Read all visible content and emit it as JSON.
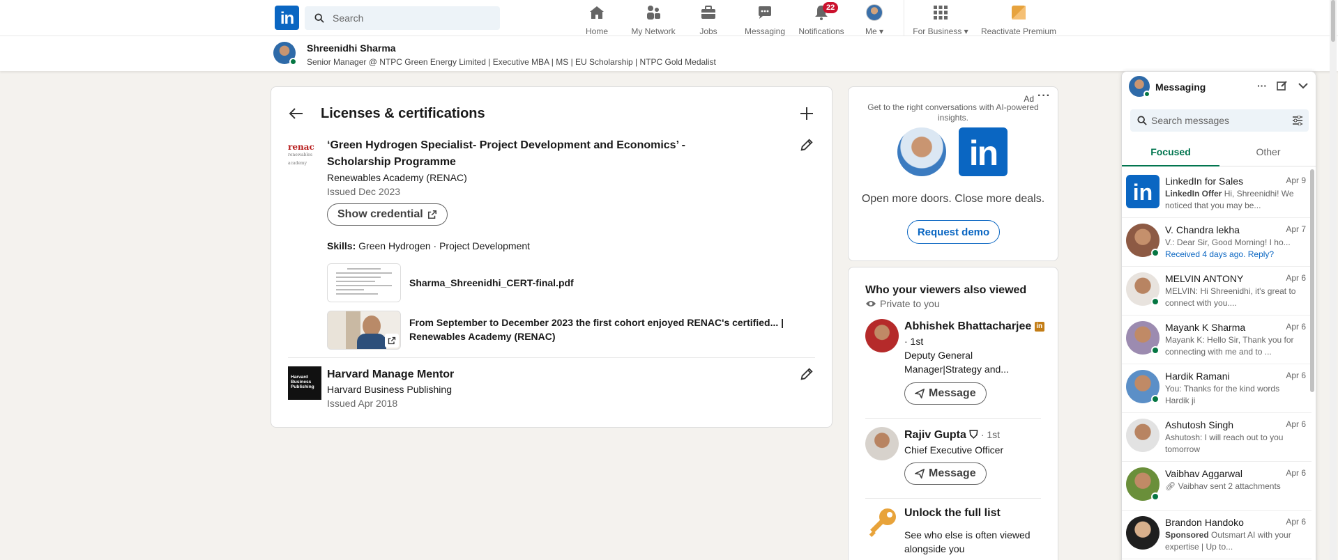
{
  "nav": {
    "search_placeholder": "Search",
    "items": [
      {
        "label": "Home",
        "icon": "home-icon"
      },
      {
        "label": "My Network",
        "icon": "network-icon"
      },
      {
        "label": "Jobs",
        "icon": "jobs-icon"
      },
      {
        "label": "Messaging",
        "icon": "messaging-icon"
      },
      {
        "label": "Notifications",
        "icon": "bell-icon",
        "badge": "22"
      },
      {
        "label": "Me",
        "icon": "avatar"
      },
      {
        "label": "For Business",
        "icon": "grid-icon"
      },
      {
        "label": "Reactivate Premium",
        "icon": "premium-icon"
      }
    ],
    "logo_text": "in"
  },
  "profile_bar": {
    "name": "Shreenidhi Sharma",
    "headline": "Senior Manager @ NTPC Green Energy Limited | Executive MBA | MS | EU Scholarship | NTPC Gold Medalist"
  },
  "main": {
    "title": "Licenses & certifications",
    "certs": [
      {
        "logo_line1": "renac",
        "logo_line2": "renewables academy",
        "title": "‘Green Hydrogen Specialist- Project Development and Economics’ - Scholarship Programme",
        "issuer": "Renewables Academy (RENAC)",
        "issued": "Issued Dec 2023",
        "credential_button": "Show credential",
        "skills_label": "Skills:",
        "skills": "Green Hydrogen · Project Development",
        "media": [
          {
            "label": "Sharma_Shreenidhi_CERT-final.pdf"
          },
          {
            "label": "From September to December 2023 the first cohort enjoyed RENAC's certified... | Renewables Academy (RENAC)"
          }
        ]
      },
      {
        "logo_text": "Harvard Business Publishing",
        "title": "Harvard Manage Mentor",
        "issuer": "Harvard Business Publishing",
        "issued": "Issued Apr 2018"
      }
    ]
  },
  "ad": {
    "label": "Ad",
    "text": "Get to the right conversations with AI-powered insights.",
    "tagline": "Open more doors. Close more deals.",
    "button": "Request demo",
    "logo_text": "in"
  },
  "viewers": {
    "title": "Who your viewers also viewed",
    "private": "Private to you",
    "people": [
      {
        "name": "Abhishek Bhattacharjee",
        "degree": "· 1st",
        "headline": "Deputy General Manager|Strategy and...",
        "button": "Message"
      },
      {
        "name": "Rajiv Gupta",
        "degree": "· 1st",
        "headline": "Chief Executive Officer",
        "button": "Message"
      }
    ],
    "unlock_title": "Unlock the full list",
    "unlock_sub": "See who else is often viewed alongside you"
  },
  "messaging": {
    "title": "Messaging",
    "search_placeholder": "Search messages",
    "tabs": [
      "Focused",
      "Other"
    ],
    "conversations": [
      {
        "name": "LinkedIn for Sales",
        "date": "Apr 9",
        "prefix": "LinkedIn Offer",
        "preview": "Hi, Shreenidhi! We noticed that you may be...",
        "color": "#0a66c2"
      },
      {
        "name": "V. Chandra lekha",
        "date": "Apr 7",
        "preview": "V.: Dear Sir, Good Morning! I ho...",
        "reply": "Received 4 days ago. Reply?",
        "color": "#8d5a44"
      },
      {
        "name": "MELVIN ANTONY",
        "date": "Apr 6",
        "preview": "MELVIN: Hi Shreenidhi, it's great to connect with you....",
        "color": "#7a6a5a"
      },
      {
        "name": "Mayank K Sharma",
        "date": "Apr 6",
        "preview": "Mayank K: Hello Sir, Thank you for connecting with me and to ...",
        "color": "#9c8bb0"
      },
      {
        "name": "Hardik Ramani",
        "date": "Apr 6",
        "preview": "You: Thanks for the kind words Hardik ji",
        "color": "#5b8fc7"
      },
      {
        "name": "Ashutosh Singh",
        "date": "Apr 6",
        "preview": "Ashutosh: I will reach out to you tomorrow",
        "color": "#6e6e6e"
      },
      {
        "name": "Vaibhav Aggarwal",
        "date": "Apr 6",
        "preview": "Vaibhav sent 2 attachments",
        "color": "#6a8f3a"
      },
      {
        "name": "Brandon Handoko",
        "date": "Apr 6",
        "prefix": "Sponsored",
        "preview": "Outsmart AI with your expertise | Up to...",
        "color": "#2b2b2b"
      }
    ]
  }
}
